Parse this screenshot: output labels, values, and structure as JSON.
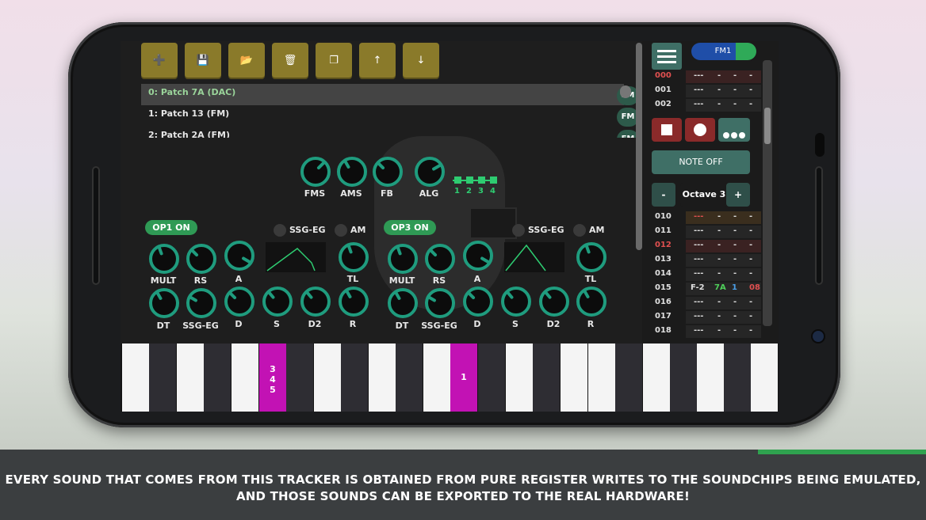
{
  "toolbar": {
    "buttons": [
      {
        "name": "add-patch-button",
        "icon": "plus-icon",
        "glyph": "➕"
      },
      {
        "name": "save-patch-button",
        "icon": "save-icon",
        "glyph": "💾"
      },
      {
        "name": "open-patch-button",
        "icon": "folder-icon",
        "glyph": "📂"
      },
      {
        "name": "delete-patch-button",
        "icon": "trash-icon",
        "glyph": "🗑"
      },
      {
        "name": "copy-patch-button",
        "icon": "copy-icon",
        "glyph": "❐"
      },
      {
        "name": "move-up-button",
        "icon": "arrow-up-icon",
        "glyph": "↑"
      },
      {
        "name": "move-down-button",
        "icon": "arrow-down-icon",
        "glyph": "↓"
      }
    ]
  },
  "patches": [
    {
      "label": "0: Patch 7A (DAC)",
      "type": "FM",
      "selected": true
    },
    {
      "label": "1: Patch 13 (FM)",
      "type": "FM",
      "selected": false
    },
    {
      "label": "2: Patch 2A (FM)",
      "type": "FM",
      "selected": false
    }
  ],
  "global_knobs": {
    "fms": "FMS",
    "ams": "AMS",
    "fb": "FB",
    "alg": "ALG"
  },
  "algorithm": {
    "ops": [
      "1",
      "2",
      "3",
      "4"
    ]
  },
  "op1": {
    "toggle": "OP1  ON",
    "ssg_eg": "SSG-EG",
    "am": "AM",
    "row1": [
      "MULT",
      "RS",
      "A",
      "TL"
    ],
    "row2": [
      "DT",
      "SSG-EG",
      "D",
      "S",
      "D2",
      "R"
    ]
  },
  "op3": {
    "toggle": "OP3  ON",
    "ssg_eg": "SSG-EG",
    "am": "AM",
    "row1": [
      "MULT",
      "RS",
      "A",
      "TL"
    ],
    "row2": [
      "DT",
      "SSG-EG",
      "D",
      "S",
      "D2",
      "R"
    ]
  },
  "keyboard": {
    "highlight1": [
      "3",
      "4",
      "5"
    ],
    "highlight2": "1",
    "highlight_color": "#c212b4"
  },
  "tracker": {
    "channel_tab": "FM1",
    "rows_top": [
      {
        "num": "000",
        "red": true,
        "note": "---",
        "a": "-",
        "b": "-",
        "c": "-"
      },
      {
        "num": "001",
        "red": false,
        "note": "---",
        "a": "-",
        "b": "-",
        "c": "-"
      },
      {
        "num": "002",
        "red": false,
        "note": "---",
        "a": "-",
        "b": "-",
        "c": "-"
      }
    ],
    "note_off": "NOTE OFF",
    "octave_minus": "-",
    "octave_label": "Octave 3",
    "octave_plus": "+",
    "rows_bottom": [
      {
        "num": "010",
        "red": false,
        "note": "---",
        "a": "-",
        "b": "-",
        "c": "-"
      },
      {
        "num": "011",
        "red": false,
        "note": "---",
        "a": "-",
        "b": "-",
        "c": "-"
      },
      {
        "num": "012",
        "red": true,
        "note": "---",
        "a": "-",
        "b": "-",
        "c": "-"
      },
      {
        "num": "013",
        "red": false,
        "note": "---",
        "a": "-",
        "b": "-",
        "c": "-"
      },
      {
        "num": "014",
        "red": false,
        "note": "---",
        "a": "-",
        "b": "-",
        "c": "-"
      },
      {
        "num": "015",
        "red": false,
        "note": "F-2",
        "a": "7A",
        "b": "1",
        "c": "08"
      },
      {
        "num": "016",
        "red": false,
        "note": "---",
        "a": "-",
        "b": "-",
        "c": "-"
      },
      {
        "num": "017",
        "red": false,
        "note": "---",
        "a": "-",
        "b": "-",
        "c": "-"
      },
      {
        "num": "018",
        "red": false,
        "note": "---",
        "a": "-",
        "b": "-",
        "c": "-"
      }
    ],
    "colors": {
      "stop": "#8a2a2a",
      "record": "#8a2a2a",
      "more": "#3f6f66"
    }
  },
  "caption": {
    "line1": "EVERY SOUND THAT COMES FROM THIS TRACKER IS OBTAINED FROM PURE REGISTER WRITES TO THE SOUNDCHIPS BEING EMULATED,",
    "line2": "AND THOSE SOUNDS CAN BE EXPORTED TO THE REAL HARDWARE!"
  }
}
